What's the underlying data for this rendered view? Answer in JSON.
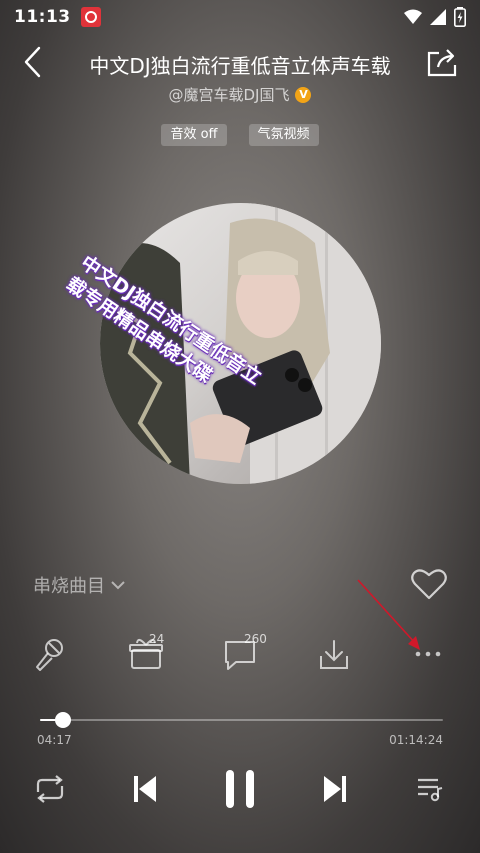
{
  "status_bar": {
    "time": "11:13"
  },
  "header": {
    "title": "中文DJ独白流行重低音立体声车载",
    "artist": "@魔宫车载DJ国飞",
    "verified_badge": "V"
  },
  "tags": [
    {
      "label": "音效 off"
    },
    {
      "label": "气氛视频"
    }
  ],
  "disc_caption": {
    "line1": "中文DJ独白流行重低音立",
    "line2": "载专用精品串烧大碟"
  },
  "playlist": {
    "label": "串烧曲目"
  },
  "actions": {
    "gift_count": "24",
    "comment_count": "260"
  },
  "progress": {
    "current_time": "04:17",
    "total_time": "01:14:24",
    "fraction": 0.058
  },
  "colors": {
    "verified": "#f2a417",
    "caption_outline": "#6a2fb8",
    "annotation_arrow": "#d0182a",
    "status_app": "#e0333a"
  },
  "icons": {
    "back": "chevron-left-icon",
    "share": "share-icon",
    "heart": "heart-icon",
    "mic": "microphone-icon",
    "gift": "gift-icon",
    "comment": "comment-icon",
    "download": "download-icon",
    "more": "more-dots-icon",
    "repeat": "repeat-icon",
    "prev": "previous-icon",
    "pause": "pause-icon",
    "next": "next-icon",
    "queue": "playlist-icon"
  }
}
